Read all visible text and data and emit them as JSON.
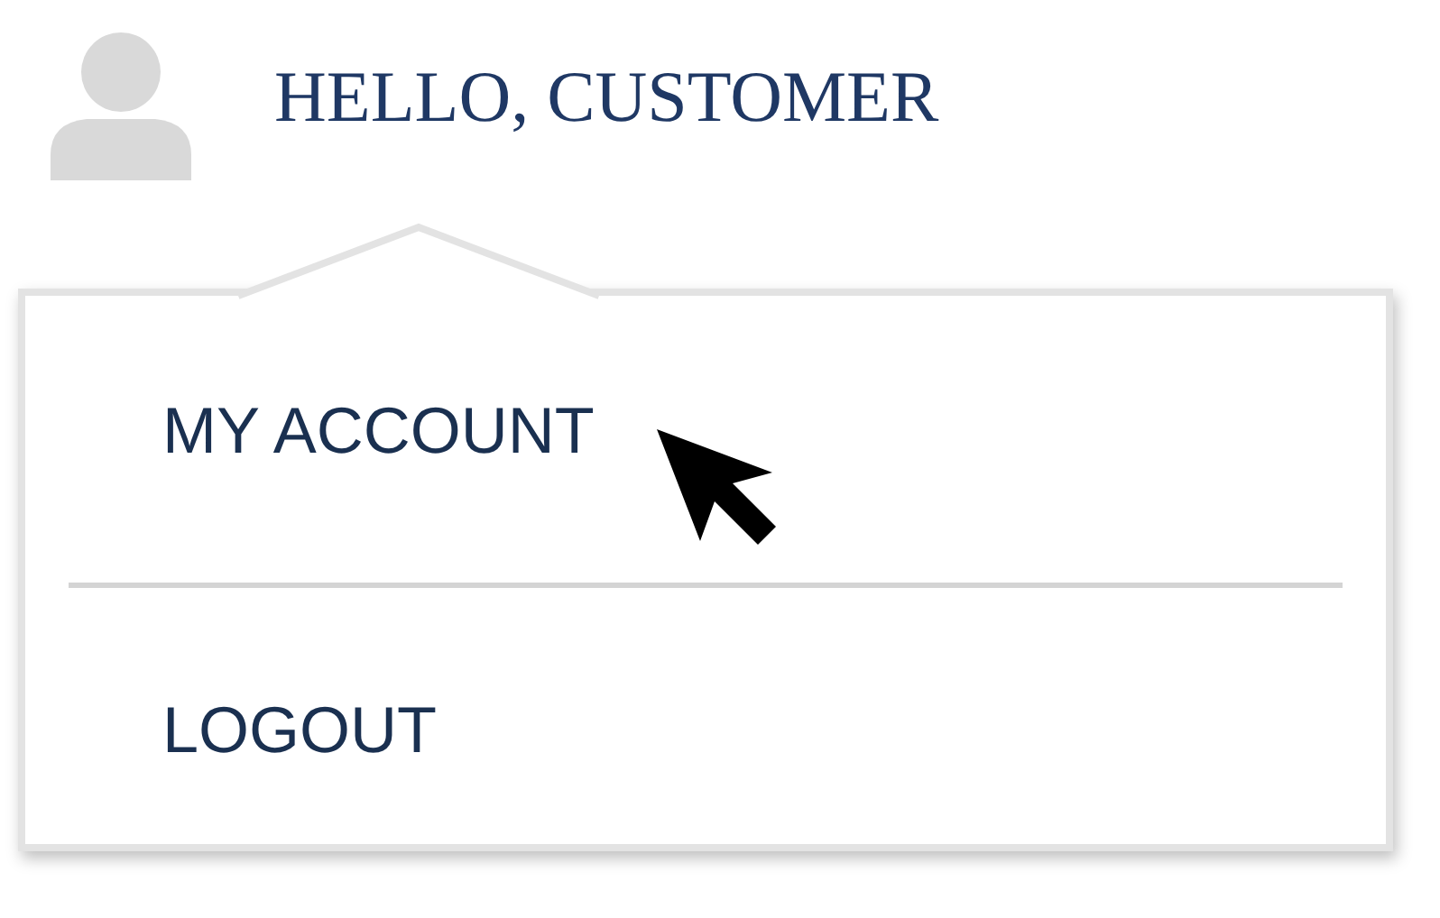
{
  "greeting": "HELLO, CUSTOMER",
  "menu": {
    "items": [
      {
        "label": "MY ACCOUNT"
      },
      {
        "label": "LOGOUT"
      }
    ]
  }
}
